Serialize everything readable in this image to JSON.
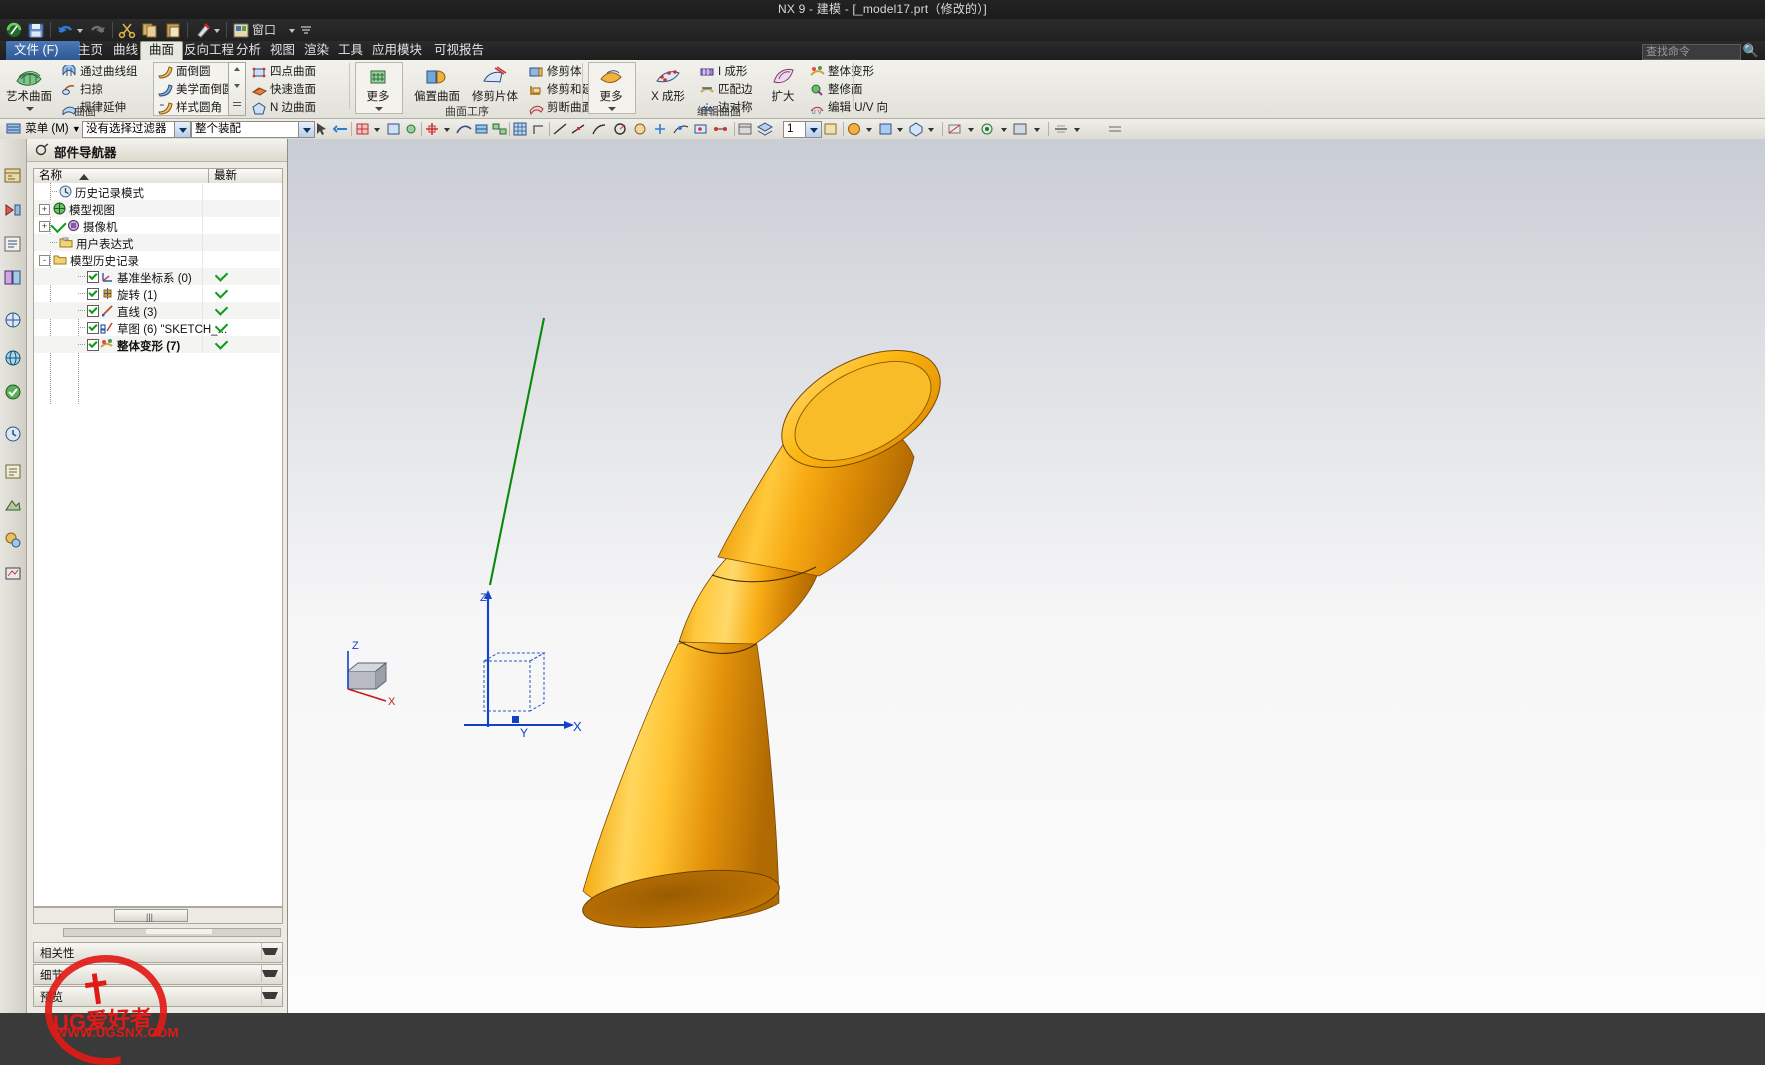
{
  "window": {
    "title": "NX 9 - 建模 - [_model17.prt（修改的）]"
  },
  "quick_access": {
    "items": [
      {
        "name": "nx-logo-icon",
        "label": "NX"
      },
      {
        "name": "save-icon",
        "label": "保存"
      },
      {
        "name": "undo-icon",
        "label": "撤消"
      },
      {
        "name": "undo-dropdown-icon",
        "label": "撤消选项"
      },
      {
        "name": "redo-icon",
        "label": "重做"
      },
      {
        "name": "cut-icon",
        "label": "剪切"
      },
      {
        "name": "copy-icon",
        "label": "复制"
      },
      {
        "name": "paste-icon",
        "label": "粘贴"
      },
      {
        "name": "paint-icon",
        "label": "颜色"
      },
      {
        "name": "paint-dropdown-icon",
        "label": "颜色选项"
      }
    ],
    "window_menu": "窗口",
    "more_label": "更多"
  },
  "tabs": {
    "file": "文件 (F)",
    "items": [
      {
        "label": "主页",
        "active": false
      },
      {
        "label": "曲线",
        "active": false
      },
      {
        "label": "曲面",
        "active": true
      },
      {
        "label": "反向工程",
        "active": false
      },
      {
        "label": "分析",
        "active": false
      },
      {
        "label": "视图",
        "active": false
      },
      {
        "label": "渲染",
        "active": false
      },
      {
        "label": "工具",
        "active": false
      },
      {
        "label": "应用模块",
        "active": false
      },
      {
        "label": "可视报告",
        "active": false
      }
    ],
    "search_placeholder": "查找命令"
  },
  "ribbon": {
    "groups": [
      {
        "name": "surface",
        "label": "曲面",
        "big_buttons": [
          {
            "label": "艺术曲面",
            "icon": "art-surface-icon",
            "has_arrow": true
          }
        ],
        "small_buttons": [
          {
            "label": "通过曲线组",
            "icon": "through-curves-icon"
          },
          {
            "label": "扫掠",
            "icon": "sweep-icon"
          },
          {
            "label": "规律延伸",
            "icon": "law-extension-icon"
          },
          {
            "label": "面倒圆",
            "icon": "face-blend-icon"
          },
          {
            "label": "美学面倒圆",
            "icon": "aesthetic-face-blend-icon"
          },
          {
            "label": "样式圆角",
            "icon": "styled-blend-icon"
          },
          {
            "label": "四点曲面",
            "icon": "four-point-surface-icon"
          },
          {
            "label": "快速造面",
            "icon": "quick-surface-icon"
          },
          {
            "label": "N 边曲面",
            "icon": "n-sided-surface-icon"
          }
        ],
        "more_label": "更多"
      },
      {
        "name": "surface-operation",
        "label": "曲面工序",
        "big_buttons": [
          {
            "label": "更多",
            "icon": "more-green-icon",
            "has_arrow": true
          }
        ],
        "small_buttons": [
          {
            "label": "偏置曲面",
            "icon": "offset-surface-icon"
          },
          {
            "label": "修剪片体",
            "icon": "trim-sheet-icon"
          },
          {
            "label": "修剪体",
            "icon": "trim-body-icon"
          },
          {
            "label": "修剪和延伸",
            "icon": "trim-and-extend-icon"
          },
          {
            "label": "剪断曲面",
            "icon": "divide-surface-icon"
          }
        ]
      },
      {
        "name": "edit-surface",
        "label": "编辑曲面",
        "big_buttons": [
          {
            "label": "更多",
            "icon": "more-uv-icon",
            "has_arrow": true
          }
        ],
        "small_buttons": [
          {
            "label": "X 成形",
            "icon": "x-form-icon"
          },
          {
            "label": "I 成形",
            "icon": "i-form-icon"
          },
          {
            "label": "匹配边",
            "icon": "match-edge-icon"
          },
          {
            "label": "边对称",
            "icon": "edge-symmetry-icon"
          },
          {
            "label": "扩大",
            "icon": "enlarge-icon"
          },
          {
            "label": "整体变形",
            "icon": "global-shaping-icon"
          },
          {
            "label": "整修面",
            "icon": "reshape-face-icon"
          },
          {
            "label": "编辑 U/V 向",
            "icon": "edit-uv-icon"
          }
        ]
      }
    ]
  },
  "selection_bar": {
    "menu_label": "菜单 (M)",
    "filter_value": "没有选择过滤器",
    "scope_value": "整个装配",
    "spin_value": "1",
    "icons": [
      {
        "name": "select-general-icon"
      },
      {
        "name": "deselect-icon"
      },
      {
        "name": "select-face-icon"
      },
      {
        "name": "select-face-dropdown-icon"
      },
      {
        "name": "select-edge-icon"
      },
      {
        "name": "select-vertex-icon"
      },
      {
        "name": "snap-point-icon"
      },
      {
        "name": "snap-point-dropdown-icon"
      },
      {
        "name": "curve-rule-icon"
      },
      {
        "name": "curve-rule-2-icon"
      },
      {
        "name": "curve-chain-icon"
      },
      {
        "name": "stop-at-intersection-icon"
      },
      {
        "name": "follow-fillet-icon"
      },
      {
        "name": "snap-intersection-icon"
      },
      {
        "name": "snap-midpoint-icon"
      },
      {
        "name": "snap-quadrant-icon"
      },
      {
        "name": "feature-group-icon"
      },
      {
        "name": "layer-settings-icon"
      },
      {
        "name": "workpart-icon"
      },
      {
        "name": "render-style-icon"
      },
      {
        "name": "render-style-dropdown-icon"
      },
      {
        "name": "shaded-icon"
      },
      {
        "name": "shaded-dropdown-icon"
      },
      {
        "name": "view-orient-icon"
      },
      {
        "name": "view-orient-dropdown-icon"
      },
      {
        "name": "hide-icon"
      },
      {
        "name": "show-all-icon"
      },
      {
        "name": "background-icon"
      }
    ]
  },
  "left_rail": {
    "items": [
      {
        "name": "rail-assembly-navigator-icon"
      },
      {
        "name": "rail-constraint-navigator-icon"
      },
      {
        "name": "rail-part-navigator-icon"
      },
      {
        "name": "rail-reuse-library-icon"
      },
      {
        "name": "rail-hd3d-tools-icon"
      },
      {
        "name": "rail-web-browser-icon"
      },
      {
        "name": "rail-history-icon"
      },
      {
        "name": "rail-process-studio-icon"
      },
      {
        "name": "rail-role-icon"
      },
      {
        "name": "rail-system-scene-icon"
      },
      {
        "name": "rail-system-materials-icon"
      },
      {
        "name": "rail-system-visual-icon"
      }
    ]
  },
  "navigator": {
    "title": "部件导航器",
    "columns": {
      "name": "名称",
      "status": "最新"
    },
    "tree": [
      {
        "label": "历史记录模式",
        "icon": "clock-icon",
        "indent": 1,
        "expander": null,
        "checkbox": false,
        "status": false,
        "bold": false
      },
      {
        "label": "模型视图",
        "icon": "model-views-icon",
        "indent": 0,
        "expander": "+",
        "checkbox": false,
        "status": false,
        "bold": false
      },
      {
        "label": "摄像机",
        "icon": "camera-icon",
        "indent": 0,
        "expander": "+",
        "checkbox": false,
        "status": false,
        "bold": false,
        "precheck": true
      },
      {
        "label": "用户表达式",
        "icon": "folder-icon",
        "indent": 1,
        "expander": null,
        "checkbox": false,
        "status": false,
        "bold": false
      },
      {
        "label": "模型历史记录",
        "icon": "folder-open-icon",
        "indent": 0,
        "expander": "-",
        "checkbox": false,
        "status": false,
        "bold": false
      },
      {
        "label": "基准坐标系 (0)",
        "icon": "datum-csys-icon",
        "indent": 2,
        "expander": null,
        "checkbox": true,
        "status": true,
        "bold": false
      },
      {
        "label": "旋转 (1)",
        "icon": "revolve-icon",
        "indent": 2,
        "expander": null,
        "checkbox": true,
        "status": true,
        "bold": false
      },
      {
        "label": "直线 (3)",
        "icon": "line-icon",
        "indent": 2,
        "expander": null,
        "checkbox": true,
        "status": true,
        "bold": false
      },
      {
        "label": "草图 (6) \"SKETCH_...",
        "icon": "sketch-icon",
        "indent": 2,
        "expander": null,
        "checkbox": true,
        "status": true,
        "bold": false
      },
      {
        "label": "整体变形 (7)",
        "icon": "global-shaping-icon",
        "indent": 2,
        "expander": null,
        "checkbox": true,
        "status": true,
        "bold": true
      }
    ],
    "panels": [
      {
        "label": "相关性",
        "name": "dependencies-panel"
      },
      {
        "label": "细节",
        "name": "details-panel"
      },
      {
        "label": "预览",
        "name": "preview-panel"
      }
    ]
  },
  "viewport": {
    "model_color_light": "#ffd24a",
    "model_color_mid": "#f5a000",
    "model_color_dark": "#b86800",
    "axis_x_label": "X",
    "axis_y_label": "Y",
    "axis_z_label": "Z",
    "triad": {
      "x": "X",
      "y": "Y",
      "z": "Z"
    }
  },
  "watermark": {
    "text": "UG爱好者",
    "url": "WWW.UGSNX.COM"
  }
}
